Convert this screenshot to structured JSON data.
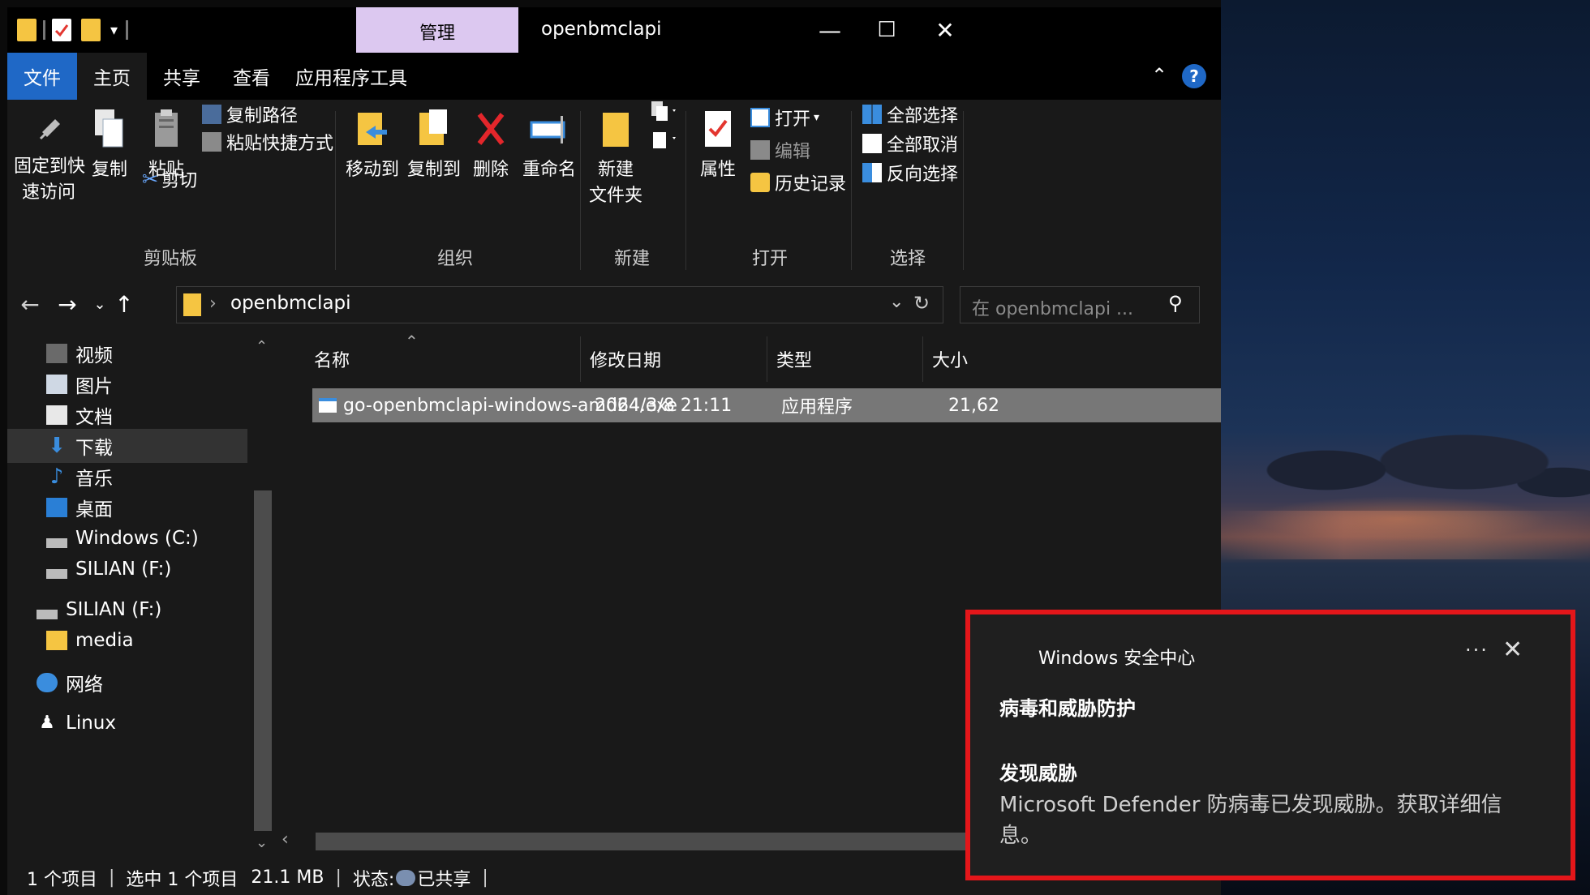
{
  "window": {
    "title": "openbmclapi",
    "context_tab": "管理",
    "controls": {
      "minimize": "—",
      "maximize": "☐",
      "close": "✕"
    }
  },
  "menu": {
    "file": "文件",
    "home": "主页",
    "share": "共享",
    "view": "查看",
    "app_tools": "应用程序工具"
  },
  "ribbon": {
    "clipboard": {
      "pin_line1": "固定到快",
      "pin_line2": "速访问",
      "copy": "复制",
      "paste": "粘贴",
      "copy_path": "复制路径",
      "paste_shortcut": "粘贴快捷方式",
      "cut": "剪切",
      "label": "剪贴板"
    },
    "organize": {
      "move_to": "移动到",
      "copy_to": "复制到",
      "delete": "删除",
      "rename": "重命名",
      "label": "组织"
    },
    "new": {
      "new_folder_line1": "新建",
      "new_folder_line2": "文件夹",
      "label": "新建"
    },
    "open": {
      "properties": "属性",
      "open": "打开",
      "edit": "编辑",
      "history": "历史记录",
      "label": "打开"
    },
    "select": {
      "select_all": "全部选择",
      "select_none": "全部取消",
      "invert": "反向选择",
      "label": "选择"
    }
  },
  "address": {
    "path": "openbmclapi",
    "search_placeholder": "在 openbmclapi ..."
  },
  "nav_pane": {
    "items": [
      {
        "label": "视频"
      },
      {
        "label": "图片"
      },
      {
        "label": "文档"
      },
      {
        "label": "下载"
      },
      {
        "label": "音乐"
      },
      {
        "label": "桌面"
      },
      {
        "label": "Windows (C:)"
      },
      {
        "label": "SILIAN (F:)"
      },
      {
        "label": "SILIAN (F:)"
      },
      {
        "label": "media"
      },
      {
        "label": "网络"
      },
      {
        "label": "Linux"
      }
    ]
  },
  "columns": {
    "name": "名称",
    "modified": "修改日期",
    "type": "类型",
    "size": "大小"
  },
  "files": [
    {
      "name": "go-openbmclapi-windows-amd64.exe",
      "modified": "2024/3/8 21:11",
      "type": "应用程序",
      "size": "21,62"
    }
  ],
  "status": {
    "count": "1 个项目",
    "selected": "选中 1 个项目",
    "size": "21.1 MB",
    "state_label": "状态:",
    "state_value": "已共享"
  },
  "toast": {
    "app": "Windows 安全中心",
    "more": "···",
    "close": "✕",
    "heading": "病毒和威胁防护",
    "title": "发现威胁",
    "body": "Microsoft Defender 防病毒已发现威胁。获取详细信息。",
    "highlight_color": "#e4161a"
  },
  "colors": {
    "file_tab": "#1f68c6",
    "manage_tab": "#dcc8f0",
    "selection": "#777777"
  }
}
